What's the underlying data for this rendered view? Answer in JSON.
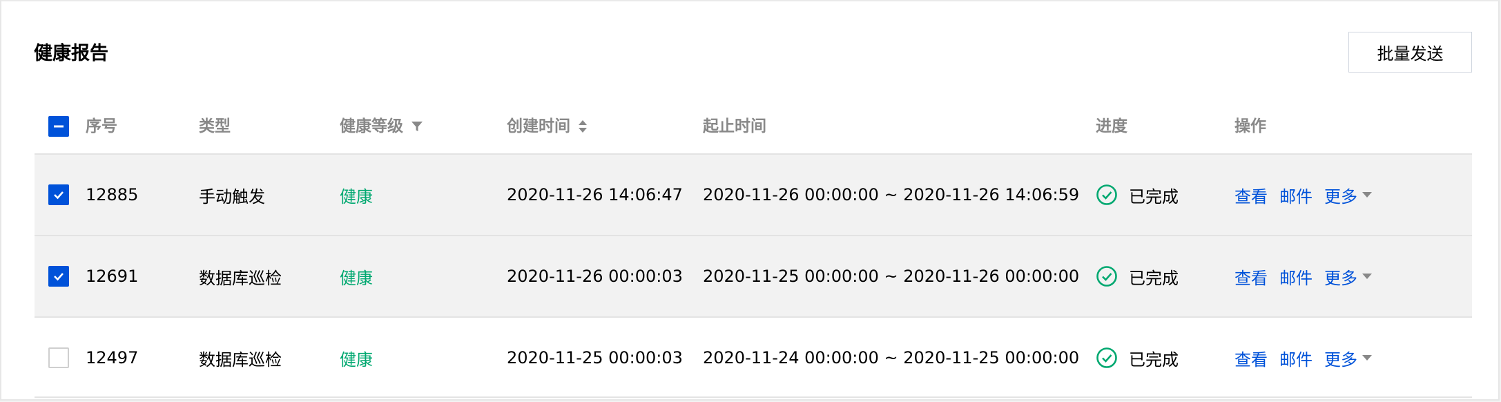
{
  "title": "健康报告",
  "batch_send_label": "批量发送",
  "columns": {
    "id": "序号",
    "type": "类型",
    "health": "健康等级",
    "created": "创建时间",
    "range": "起止时间",
    "progress": "进度",
    "actions": "操作"
  },
  "select_all_state": "indeterminate",
  "rows": [
    {
      "selected": true,
      "id": "12885",
      "type": "手动触发",
      "health": "健康",
      "created": "2020-11-26 14:06:47",
      "range": "2020-11-26 00:00:00 ~ 2020-11-26 14:06:59",
      "progress": "已完成",
      "view": "查看",
      "mail": "邮件",
      "more": "更多"
    },
    {
      "selected": true,
      "id": "12691",
      "type": "数据库巡检",
      "health": "健康",
      "created": "2020-11-26 00:00:03",
      "range": "2020-11-25 00:00:00 ~ 2020-11-26 00:00:00",
      "progress": "已完成",
      "view": "查看",
      "mail": "邮件",
      "more": "更多"
    },
    {
      "selected": false,
      "id": "12497",
      "type": "数据库巡检",
      "health": "健康",
      "created": "2020-11-25 00:00:03",
      "range": "2020-11-24 00:00:00 ~ 2020-11-25 00:00:00",
      "progress": "已完成",
      "view": "查看",
      "mail": "邮件",
      "more": "更多"
    }
  ],
  "colors": {
    "primary": "#0052d9",
    "success": "#00a870",
    "selected_row_bg": "#f2f2f2"
  },
  "icons": {
    "filter": "filter-icon",
    "sort": "sort-icon",
    "status": "check-circle-icon",
    "dropdown": "caret-down-icon"
  }
}
